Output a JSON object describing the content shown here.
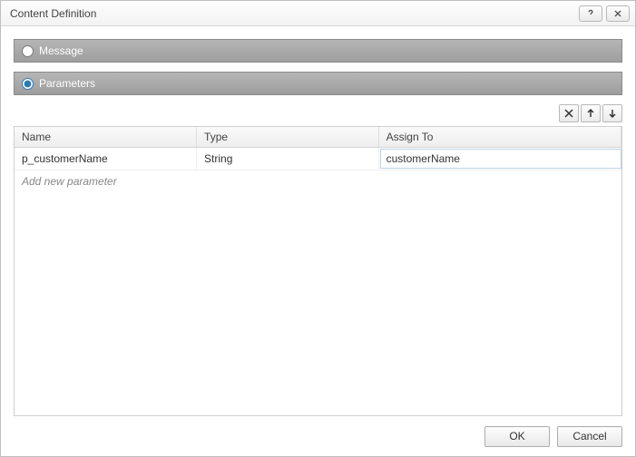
{
  "dialog": {
    "title": "Content Definition"
  },
  "options": {
    "message_label": "Message",
    "parameters_label": "Parameters",
    "selected": "parameters"
  },
  "toolbar": {
    "delete_tip": "Delete",
    "up_tip": "Move Up",
    "down_tip": "Move Down"
  },
  "grid": {
    "columns": {
      "name": "Name",
      "type": "Type",
      "assign": "Assign To"
    },
    "rows": [
      {
        "name": "p_customerName",
        "type": "String",
        "assign": "customerName"
      }
    ],
    "placeholder": "Add new parameter"
  },
  "buttons": {
    "ok": "OK",
    "cancel": "Cancel"
  }
}
